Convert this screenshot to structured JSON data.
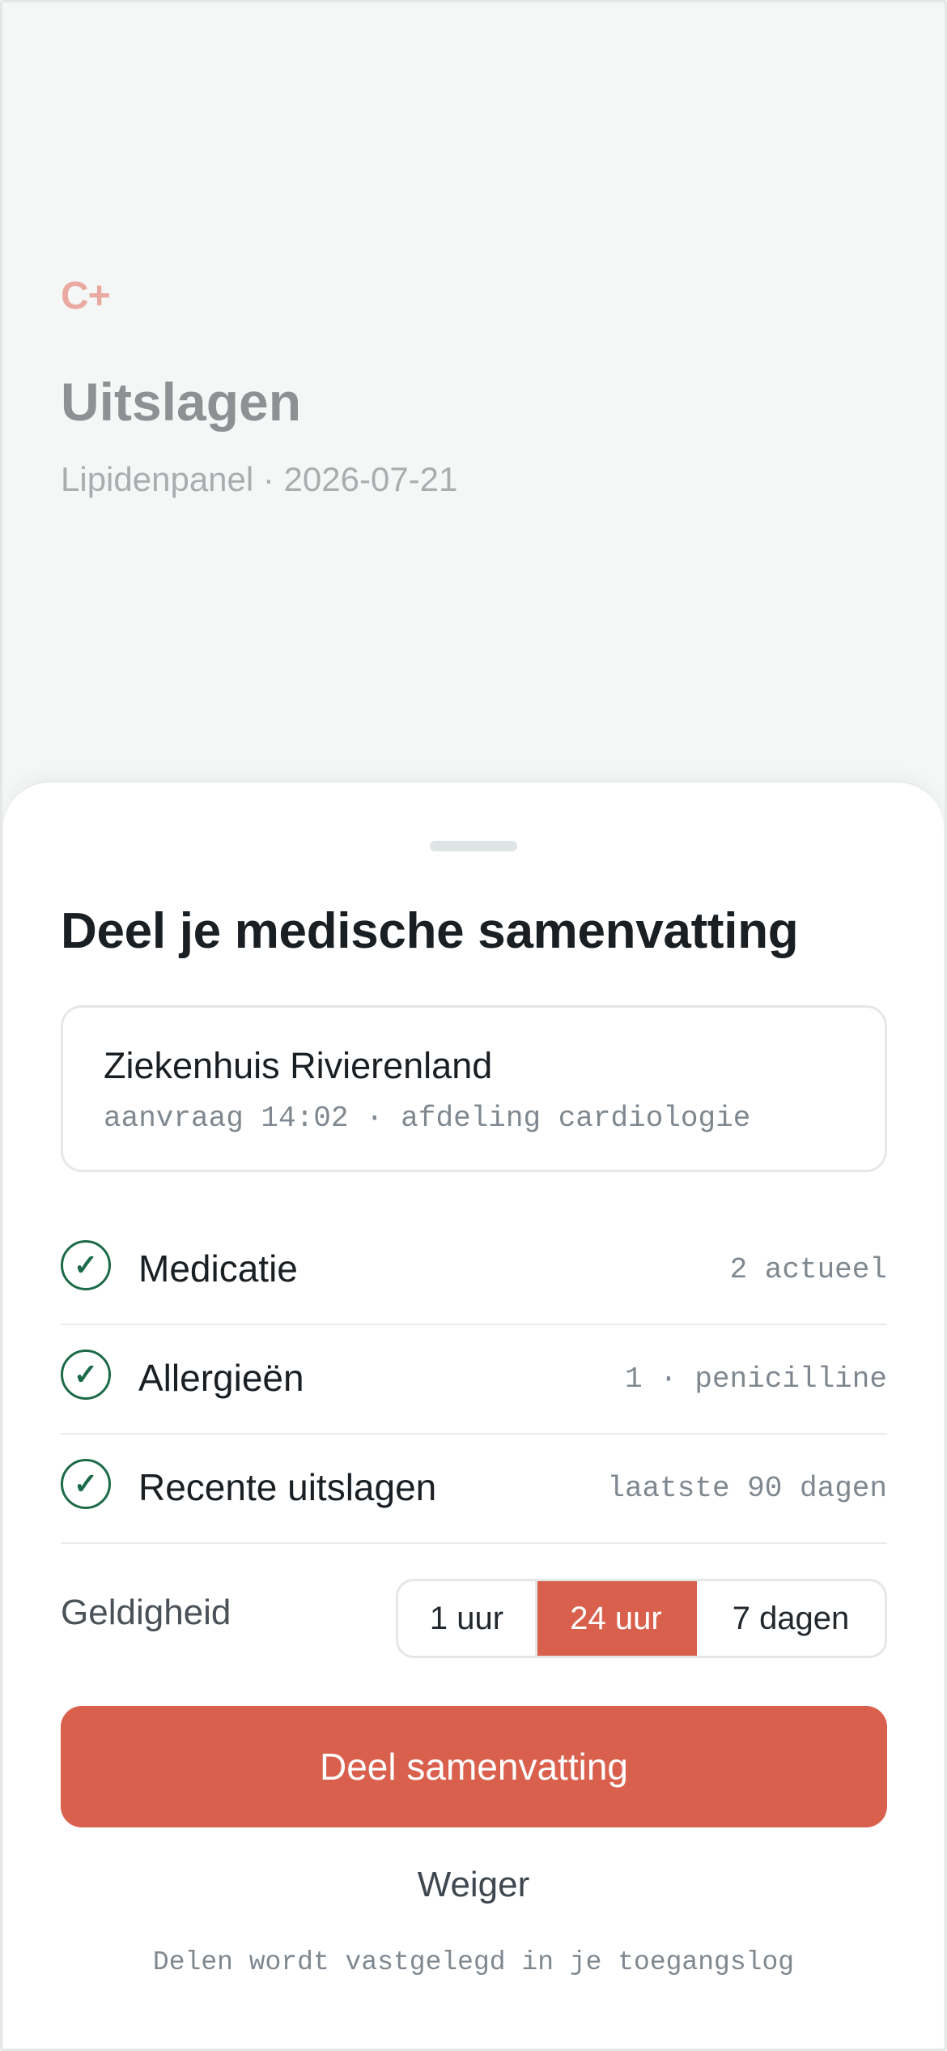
{
  "background": {
    "logo": "C+",
    "title": "Uitslagen",
    "subtitle": "Lipidenpanel · 2026-07-21"
  },
  "sheet": {
    "title": "Deel je medische samenvatting",
    "request": {
      "name": "Ziekenhuis Rivierenland",
      "meta": "aanvraag 14:02 · afdeling cardiologie"
    },
    "items": [
      {
        "label": "Medicatie",
        "value": "2 actueel",
        "icon": "check-circle-icon",
        "checked": true
      },
      {
        "label": "Allergieën",
        "value": "1 · penicilline",
        "icon": "check-circle-icon",
        "checked": true
      },
      {
        "label": "Recente uitslagen",
        "value": "laatste 90 dagen",
        "icon": "check-circle-icon",
        "checked": true
      }
    ],
    "validity": {
      "label": "Geldigheid",
      "options": [
        "1 uur",
        "24 uur",
        "7 dagen"
      ],
      "selected": "24 uur"
    },
    "share_label": "Deel samenvatting",
    "decline_label": "Weiger",
    "footnote": "Delen wordt vastgelegd in je toegangslog"
  },
  "colors": {
    "accent": "#d9604d",
    "check": "#1c6a48",
    "logo": "#eaaaa2"
  }
}
